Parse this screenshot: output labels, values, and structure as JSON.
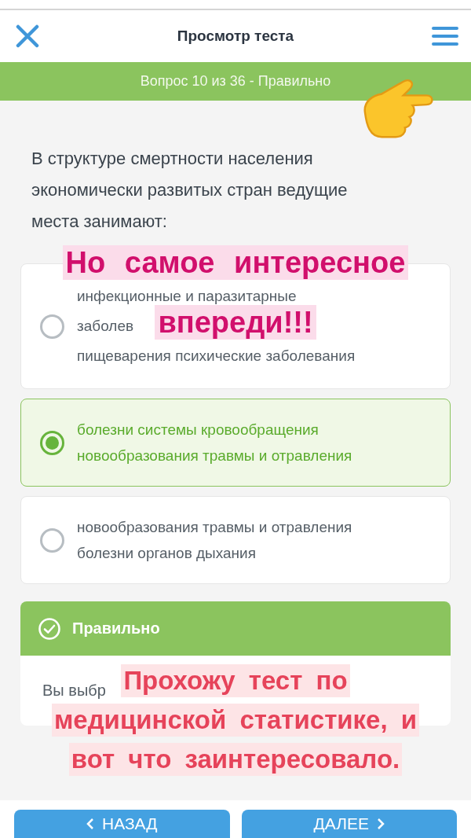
{
  "header": {
    "title": "Просмотр теста"
  },
  "status_bar": {
    "text": "Вопрос 10 из 36 - Правильно",
    "correct": true
  },
  "question": "В структуре смертности населения экономически развитых стран ведущие места занимают:",
  "options": [
    {
      "lines": [
        "инфекционные и паразитарные",
        "заболев",
        "пищеварения психические заболевания"
      ],
      "selected": false
    },
    {
      "lines": [
        "болезни системы кровообращения",
        "новообразования травмы и отравления"
      ],
      "selected": true
    },
    {
      "lines": [
        "новообразования травмы и отравления",
        "болезни органов дыхания"
      ],
      "selected": false
    }
  ],
  "feedback": {
    "title": "Правильно",
    "correct": true,
    "text": "Вы выбр"
  },
  "buttons": [
    {
      "label": "НАЗАД",
      "kind": "back"
    },
    {
      "label": "ДАЛЕЕ",
      "kind": "next"
    }
  ],
  "captions": [
    {
      "kind": "top",
      "lines": [
        "Но самое интересное",
        "впереди!!!"
      ]
    },
    {
      "kind": "bottom",
      "lines": [
        "Прохожу тест по",
        "медицинской статистике, и",
        "вот что заинтересовало."
      ]
    }
  ]
}
